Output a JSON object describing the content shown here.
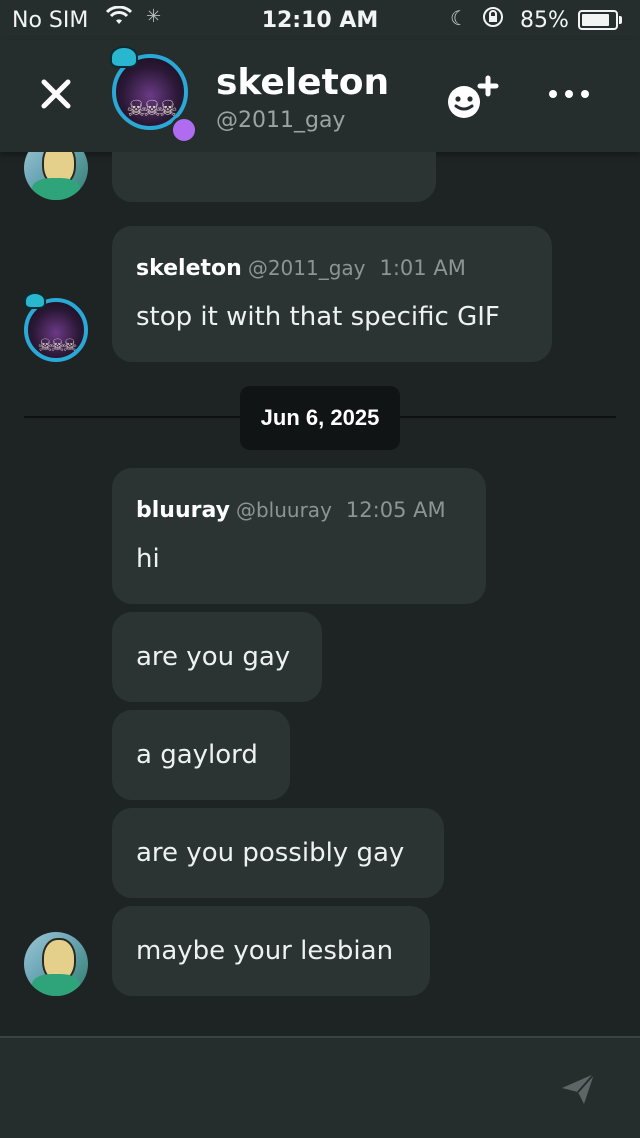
{
  "status_bar": {
    "carrier": "No SIM",
    "time": "12:10 AM",
    "battery_percent": "85%",
    "battery_level": 0.85
  },
  "header": {
    "title": "skeleton",
    "subtitle": "@2011_gay",
    "icons": [
      "close-icon",
      "add-friend-icon",
      "more-icon"
    ],
    "presence_color": "#b06cf0"
  },
  "messages": [
    {
      "author": "skeleton",
      "handle": "@2011_gay",
      "time": "1:01 AM",
      "lines": [
        "stop it with that specific GIF"
      ]
    },
    {
      "author": "bluuray",
      "handle": "@bluuray",
      "time": "12:05 AM",
      "lines": [
        "hi",
        "are you gay",
        "a gaylord",
        "are you possibly gay",
        "maybe your lesbian"
      ]
    }
  ],
  "date_divider": "Jun 6, 2025",
  "composer": {
    "placeholder": ""
  },
  "colors": {
    "accent": "#2aa9d6",
    "background": "#1e2424",
    "bubble": "#2c3333"
  }
}
